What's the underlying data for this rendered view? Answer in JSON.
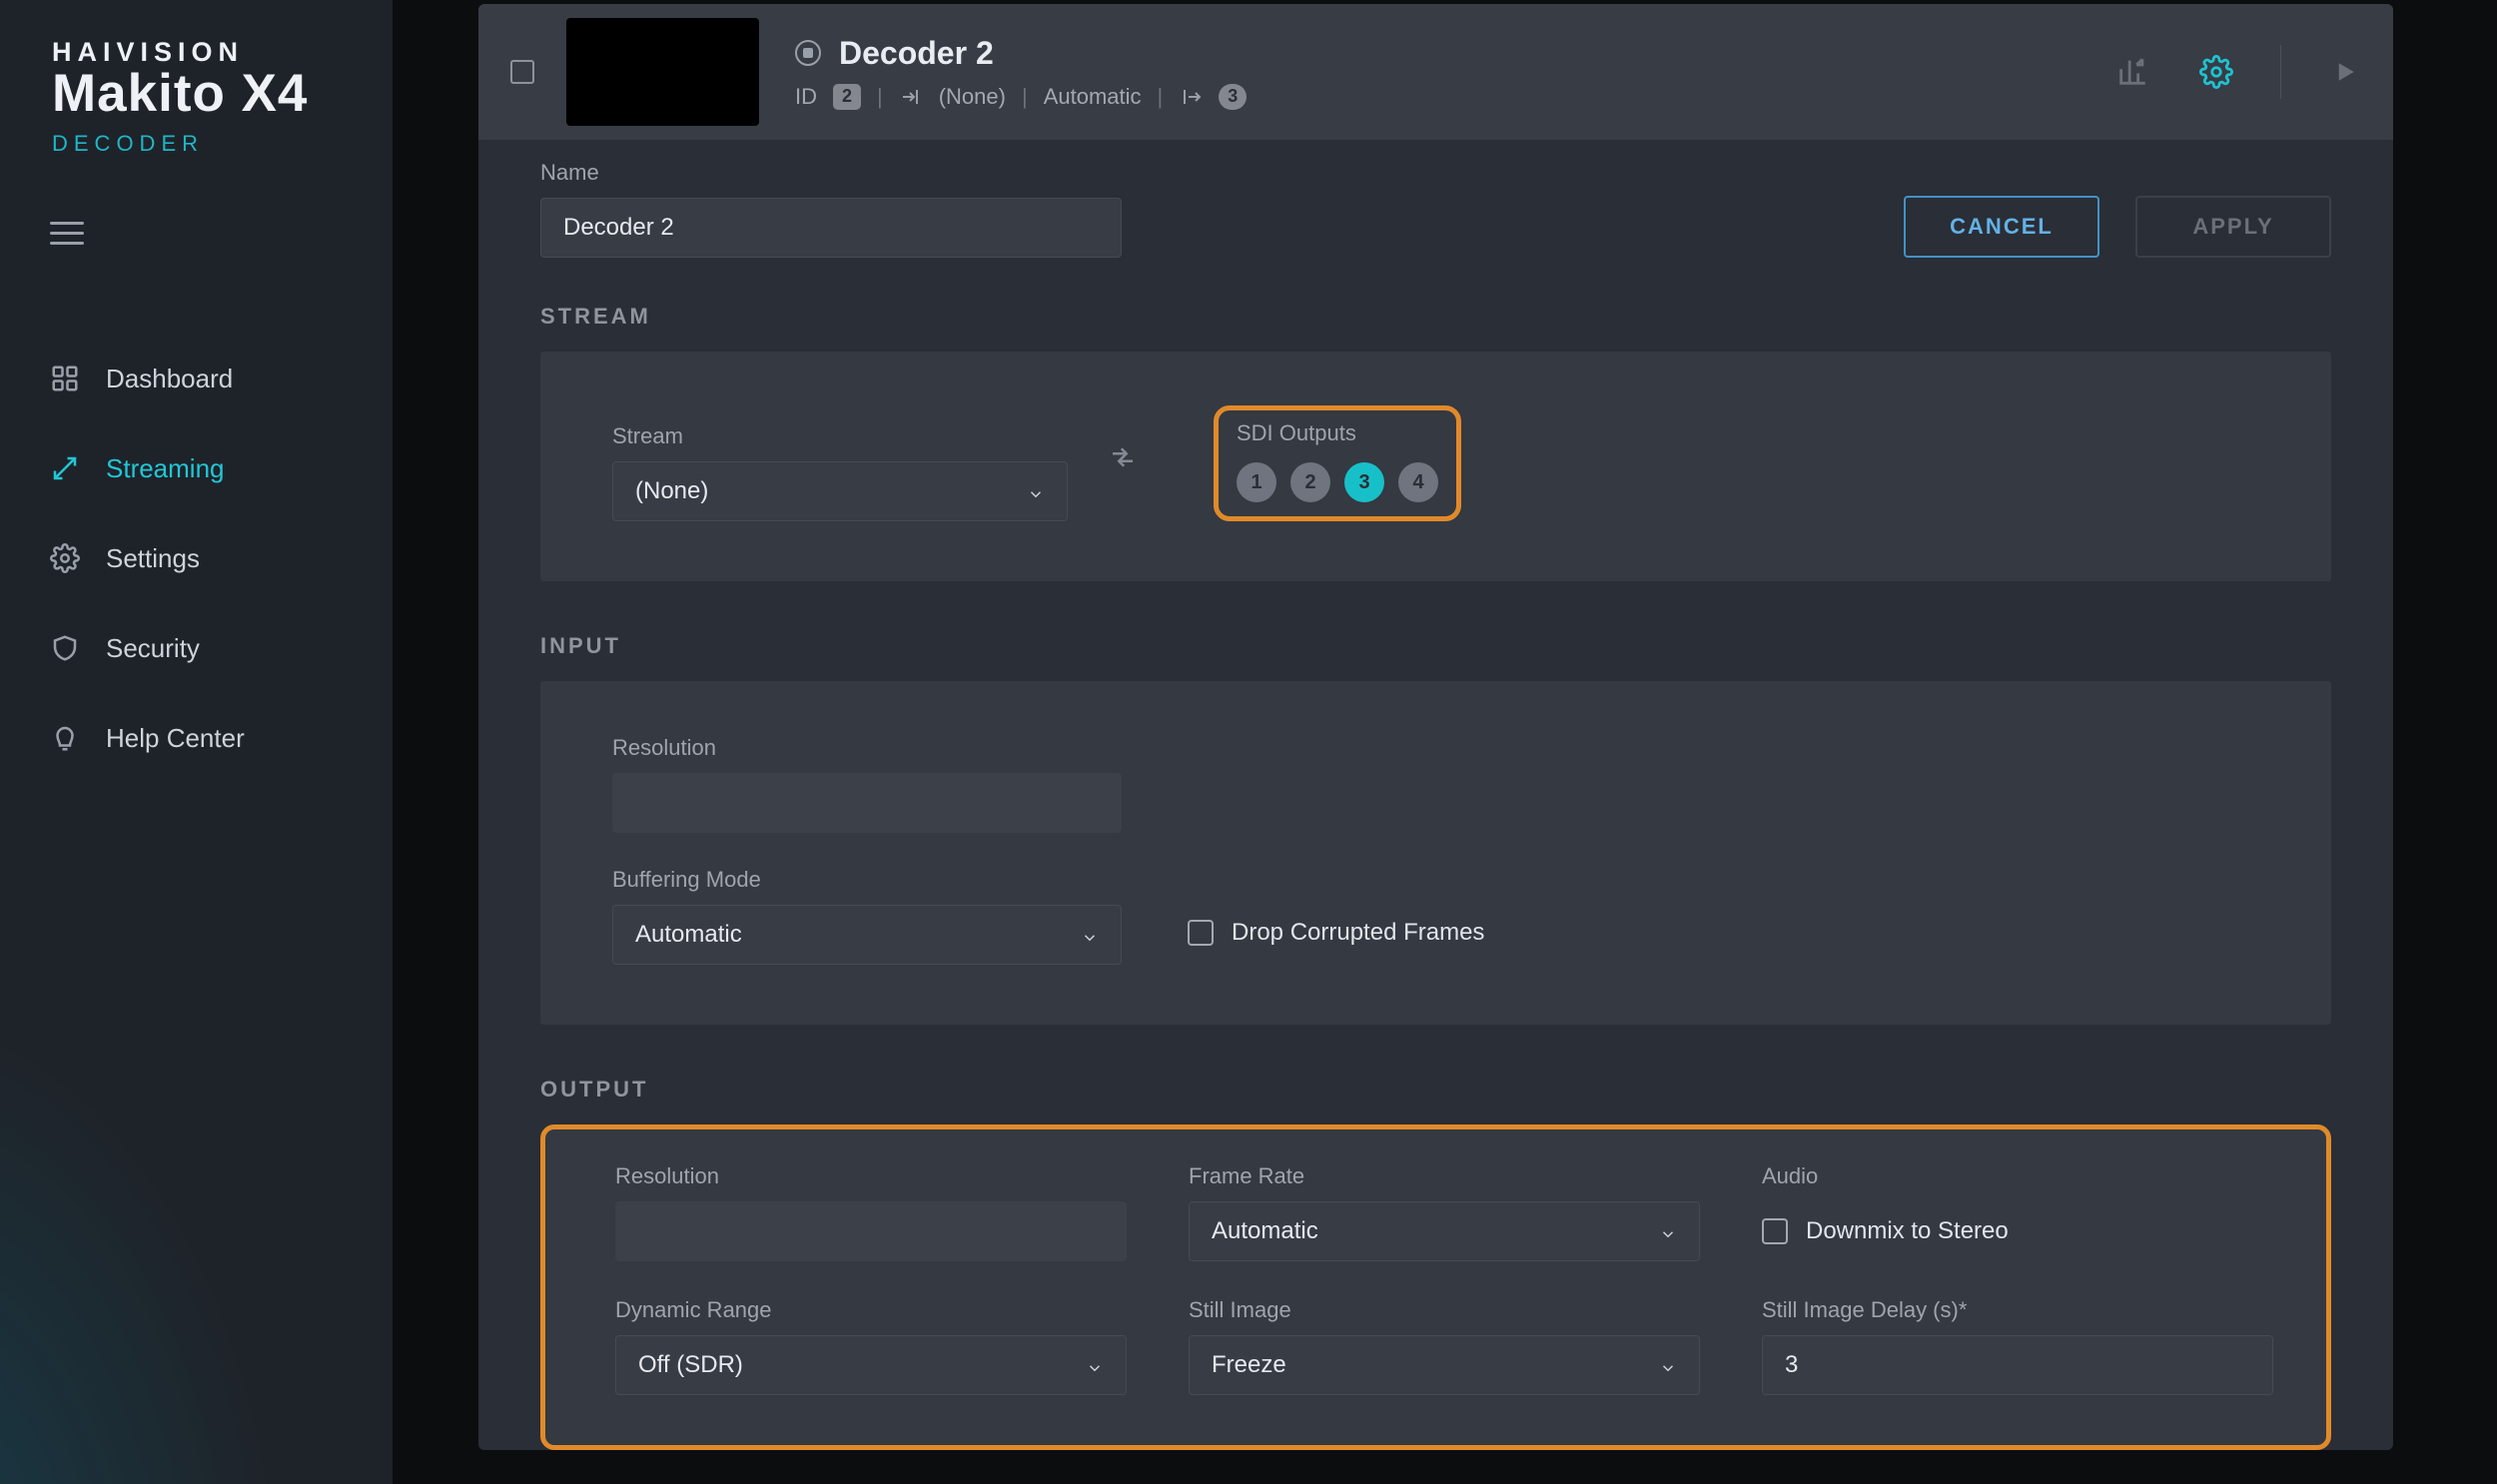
{
  "brand": {
    "line1": "HAIVISION",
    "line2": "Makito X4",
    "line3": "DECODER"
  },
  "nav": {
    "dashboard": "Dashboard",
    "streaming": "Streaming",
    "settings": "Settings",
    "security": "Security",
    "help": "Help Center"
  },
  "header": {
    "title": "Decoder 2",
    "id_label": "ID",
    "id_value": "2",
    "stream_name": "(None)",
    "mode": "Automatic",
    "out_count": "3"
  },
  "actions": {
    "cancel": "CANCEL",
    "apply": "APPLY"
  },
  "name_section": {
    "label": "Name",
    "value": "Decoder 2"
  },
  "stream": {
    "title": "STREAM",
    "stream_label": "Stream",
    "stream_value": "(None)",
    "sdi_label": "SDI Outputs",
    "sdi": {
      "b1": "1",
      "b2": "2",
      "b3": "3",
      "b4": "4",
      "active": "3"
    }
  },
  "input": {
    "title": "INPUT",
    "resolution_label": "Resolution",
    "buffering_label": "Buffering Mode",
    "buffering_value": "Automatic",
    "drop_label": "Drop Corrupted Frames"
  },
  "output": {
    "title": "OUTPUT",
    "resolution_label": "Resolution",
    "framerate_label": "Frame Rate",
    "framerate_value": "Automatic",
    "audio_label": "Audio",
    "downmix_label": "Downmix to Stereo",
    "dynrange_label": "Dynamic Range",
    "dynrange_value": "Off (SDR)",
    "still_label": "Still Image",
    "still_value": "Freeze",
    "delay_label": "Still Image Delay (s)*",
    "delay_value": "3"
  }
}
